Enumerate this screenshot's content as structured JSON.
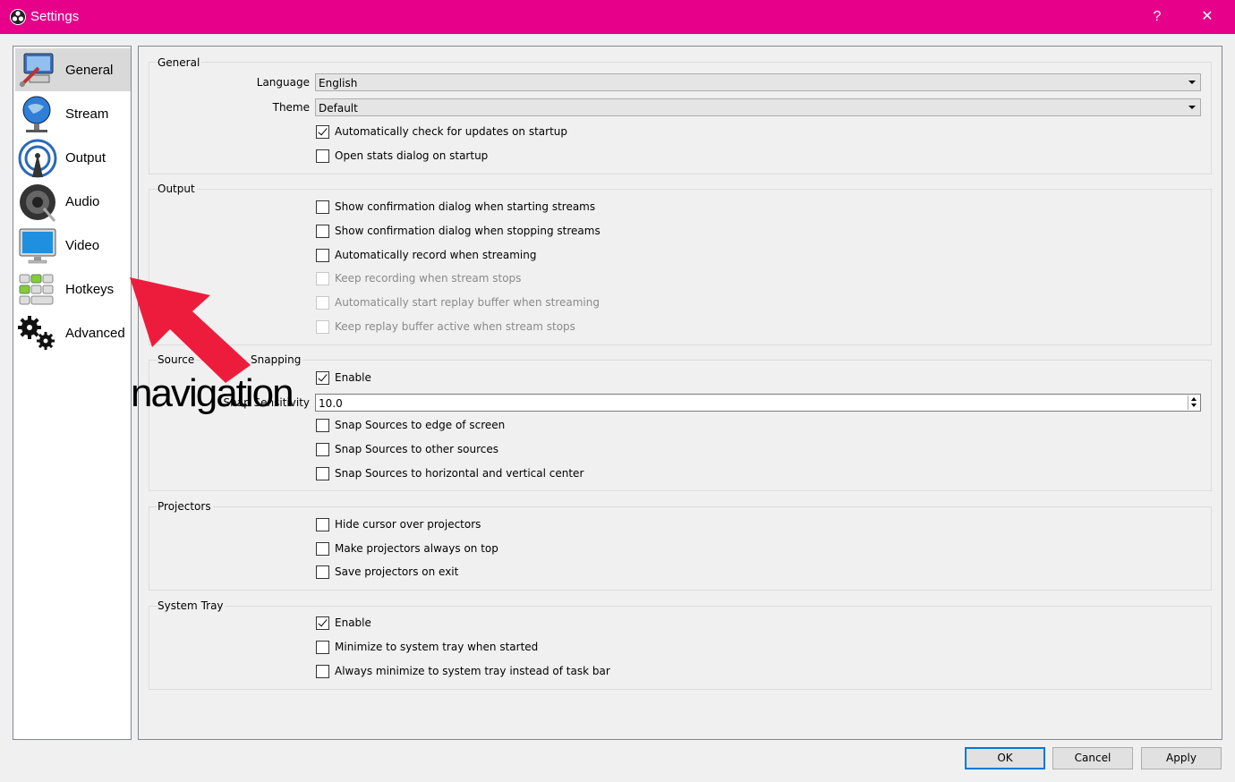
{
  "window": {
    "title": "Settings",
    "help": "?",
    "close": "✕",
    "titlebar_color": "#e6008a"
  },
  "sidebar": {
    "items": [
      {
        "label": "General",
        "icon": "general-icon",
        "active": true
      },
      {
        "label": "Stream",
        "icon": "stream-globe-icon"
      },
      {
        "label": "Output",
        "icon": "output-broadcast-icon"
      },
      {
        "label": "Audio",
        "icon": "audio-speaker-icon"
      },
      {
        "label": "Video",
        "icon": "video-monitor-icon"
      },
      {
        "label": "Hotkeys",
        "icon": "hotkeys-keyboard-icon"
      },
      {
        "label": "Advanced",
        "icon": "advanced-gears-icon"
      }
    ]
  },
  "general": {
    "title": "General",
    "language_label": "Language",
    "language_value": "English",
    "theme_label": "Theme",
    "theme_value": "Default",
    "check_updates": "Automatically check for updates on startup",
    "open_stats": "Open stats dialog on startup"
  },
  "output": {
    "title": "Output",
    "confirm_start": "Show confirmation dialog when starting streams",
    "confirm_stop": "Show confirmation dialog when stopping streams",
    "auto_record": "Automatically record when streaming",
    "keep_recording": "Keep recording when stream stops",
    "auto_replay": "Automatically start replay buffer when streaming",
    "keep_replay": "Keep replay buffer active when stream stops"
  },
  "snapping": {
    "title_left": "Source",
    "title_right": "Snapping",
    "enable": "Enable",
    "sensitivity_label": "Snap Sensitivity",
    "sensitivity_value": "10.0",
    "edge": "Snap Sources to edge of screen",
    "other": "Snap Sources to other sources",
    "center": "Snap Sources to horizontal and vertical center"
  },
  "projectors": {
    "title": "Projectors",
    "hide_cursor": "Hide cursor over projectors",
    "always_top": "Make projectors always on top",
    "save_exit": "Save projectors on exit"
  },
  "tray": {
    "title": "System Tray",
    "enable": "Enable",
    "minimize_started": "Minimize to system tray when started",
    "always_minimize": "Always minimize to system tray instead of task bar"
  },
  "buttons": {
    "ok": "OK",
    "cancel": "Cancel",
    "apply": "Apply"
  },
  "annotation": {
    "text": "navigation",
    "arrow_color": "#ee1c3c"
  }
}
